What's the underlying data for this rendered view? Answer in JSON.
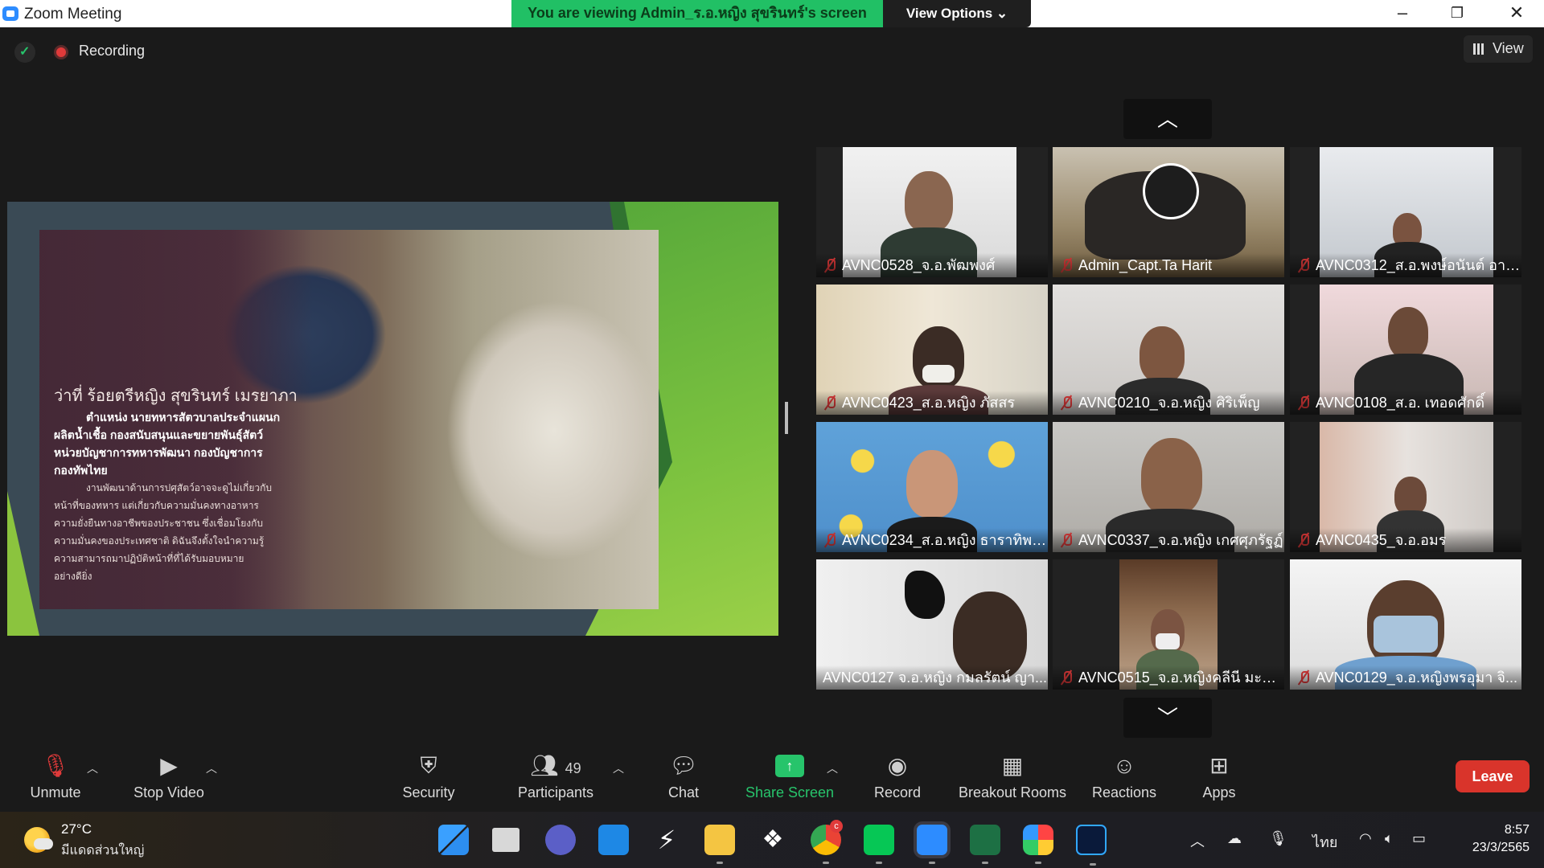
{
  "window": {
    "title": "Zoom Meeting",
    "viewing_banner": "You are viewing Admin_ร.อ.หญิง สุขรินทร์'s screen",
    "view_options_label": "View Options ⌄",
    "minimize": "–",
    "restore": "❐",
    "close": "✕"
  },
  "meeting_bar": {
    "recording_label": "Recording",
    "view_label": "View"
  },
  "shared_slide": {
    "heading": "ว่าที่ ร้อยตรีหญิง สุขรินทร์ เมรยาภา",
    "line1": "ตำแหน่ง นายทหารสัตวบาลประจำแผนก",
    "line2": "ผลิตน้ำเชื้อ กองสนับสนุนและขยายพันธุ์สัตว์",
    "line3": "หน่วยบัญชาการทหารพัฒนา กองบัญชาการ",
    "line4": "กองทัพไทย",
    "small1": "งานพัฒนาด้านการปศุสัตว์อาจจะดูไม่เกี่ยวกับ",
    "small2": "หน้าที่ของทหาร แต่เกี่ยวกับความมั่นคงทางอาหาร",
    "small3": "ความยั่งยืนทางอาชีพของประชาชน ซึ่งเชื่อมโยงกับ",
    "small4": "ความมั่นคงของประเทศชาติ ดิฉันจึงตั้งใจนำความรู้",
    "small5": "ความสามารถมาปฏิบัติหน้าที่ที่ได้รับมอบหมาย",
    "small6": "อย่างดียิ่ง"
  },
  "gallery": {
    "up_arrow": "︿",
    "down_arrow": "﹀",
    "tiles": [
      {
        "name": "AVNC0528_จ.อ.พัฒพงศ์",
        "muted": true
      },
      {
        "name": "Admin_Capt.Ta Harit",
        "muted": true
      },
      {
        "name": "AVNC0312_ส.อ.พงษ์อนันต์ อายุ...",
        "muted": true
      },
      {
        "name": "AVNC0423_ส.อ.หญิง ภัสสร",
        "muted": true
      },
      {
        "name": "AVNC0210_จ.อ.หญิง ศิริเพ็ญ",
        "muted": true
      },
      {
        "name": "AVNC0108_ส.อ. เทอดศักดิ์",
        "muted": true
      },
      {
        "name": "AVNC0234_ส.อ.หญิง ธาราทิพย์ ...",
        "muted": true
      },
      {
        "name": "AVNC0337_จ.อ.หญิง เกศศุภรัฐฏ์",
        "muted": true
      },
      {
        "name": "AVNC0435_จ.อ.อมร",
        "muted": true
      },
      {
        "name": "AVNC0127 จ.อ.หญิง กมลรัตน์ ญา...",
        "muted": false
      },
      {
        "name": "AVNC0515_จ.อ.หญิงคลีนี มะแซ...",
        "muted": true
      },
      {
        "name": "AVNC0129_จ.อ.หญิงพรอุมา จิ...",
        "muted": true
      }
    ]
  },
  "toolbar": {
    "unmute": "Unmute",
    "stop_video": "Stop Video",
    "security": "Security",
    "participants": "Participants",
    "participants_count": "49",
    "chat": "Chat",
    "share_screen": "Share Screen",
    "record": "Record",
    "breakout_rooms": "Breakout Rooms",
    "reactions": "Reactions",
    "apps": "Apps",
    "leave": "Leave"
  },
  "taskbar": {
    "temperature": "27°C",
    "condition": "มีแดดส่วนใหญ่",
    "language": "ไทย",
    "time": "8:57",
    "date": "23/3/2565",
    "chrome_badge": "c"
  },
  "colors": {
    "zoom_green": "#27c46b",
    "leave_red": "#d9342b",
    "muted_red": "#e03a3a"
  }
}
